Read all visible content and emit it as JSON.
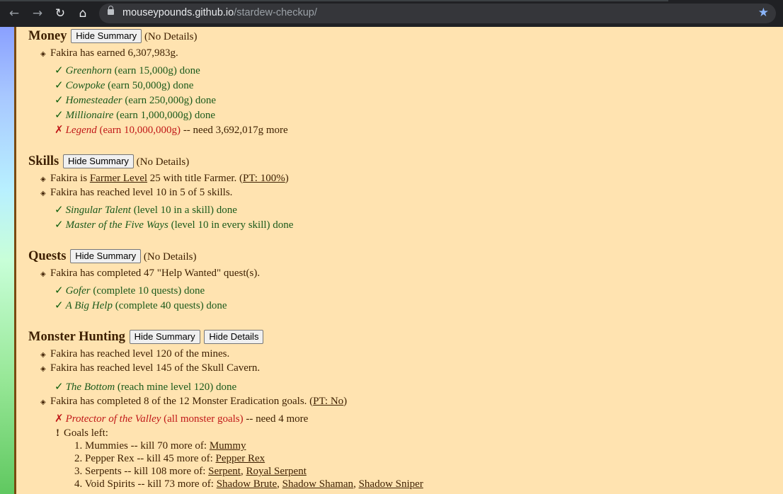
{
  "browser": {
    "url_host": "mouseypounds.github.io",
    "url_path": "/stardew-checkup/"
  },
  "money": {
    "title": "Money",
    "hide_summary": "Hide Summary",
    "no_details": "(No Details)",
    "earned": "Fakira has earned 6,307,983g.",
    "a1_name": "Greenhorn",
    "a1_rest": "(earn 15,000g) done",
    "a2_name": "Cowpoke",
    "a2_rest": "(earn 50,000g) done",
    "a3_name": "Homesteader",
    "a3_rest": "(earn 250,000g) done",
    "a4_name": "Millionaire",
    "a4_rest": "(earn 1,000,000g) done",
    "a5_name": "Legend",
    "a5_rest": "(earn 10,000,000g)",
    "a5_need": "-- need 3,692,017g more"
  },
  "skills": {
    "title": "Skills",
    "hide_summary": "Hide Summary",
    "no_details": "(No Details)",
    "l1_a": "Fakira is",
    "l1_link": "Farmer Level",
    "l1_b": "25 with title Farmer. (",
    "l1_pt": "PT: 100%",
    "l1_c": ")",
    "l2": "Fakira has reached level 10 in 5 of 5 skills.",
    "a1_name": "Singular Talent",
    "a1_rest": "(level 10 in a skill) done",
    "a2_name": "Master of the Five Ways",
    "a2_rest": "(level 10 in every skill) done"
  },
  "quests": {
    "title": "Quests",
    "hide_summary": "Hide Summary",
    "no_details": "(No Details)",
    "l1": "Fakira has completed 47 \"Help Wanted\" quest(s).",
    "a1_name": "Gofer",
    "a1_rest": "(complete 10 quests) done",
    "a2_name": "A Big Help",
    "a2_rest": "(complete 40 quests) done"
  },
  "monsters": {
    "title": "Monster Hunting",
    "hide_summary": "Hide Summary",
    "hide_details": "Hide Details",
    "l1": "Fakira has reached level 120 of the mines.",
    "l2": "Fakira has reached level 145 of the Skull Cavern.",
    "a1_name": "The Bottom",
    "a1_rest": "(reach mine level 120) done",
    "l3_a": "Fakira has completed 8 of the 12 Monster Eradication goals. (",
    "l3_pt": "PT: No",
    "l3_b": ")",
    "a2_name": "Protector of the Valley",
    "a2_rest": "(all monster goals)",
    "a2_need": "-- need 4 more",
    "goals_left": "Goals left:",
    "g1_num": "1.",
    "g1_text": "Mummies -- kill 70 more of:",
    "g1_link": "Mummy",
    "g2_num": "2.",
    "g2_text": "Pepper Rex -- kill 45 more of:",
    "g2_link": "Pepper Rex",
    "g3_num": "3.",
    "g3_text": "Serpents -- kill 108 more of:",
    "g3_link1": "Serpent",
    "g3_link2": "Royal Serpent",
    "g4_num": "4.",
    "g4_text": "Void Spirits -- kill 73 more of:",
    "g4_link1": "Shadow Brute",
    "g4_link2": "Shadow Shaman",
    "g4_link3": "Shadow Sniper"
  }
}
